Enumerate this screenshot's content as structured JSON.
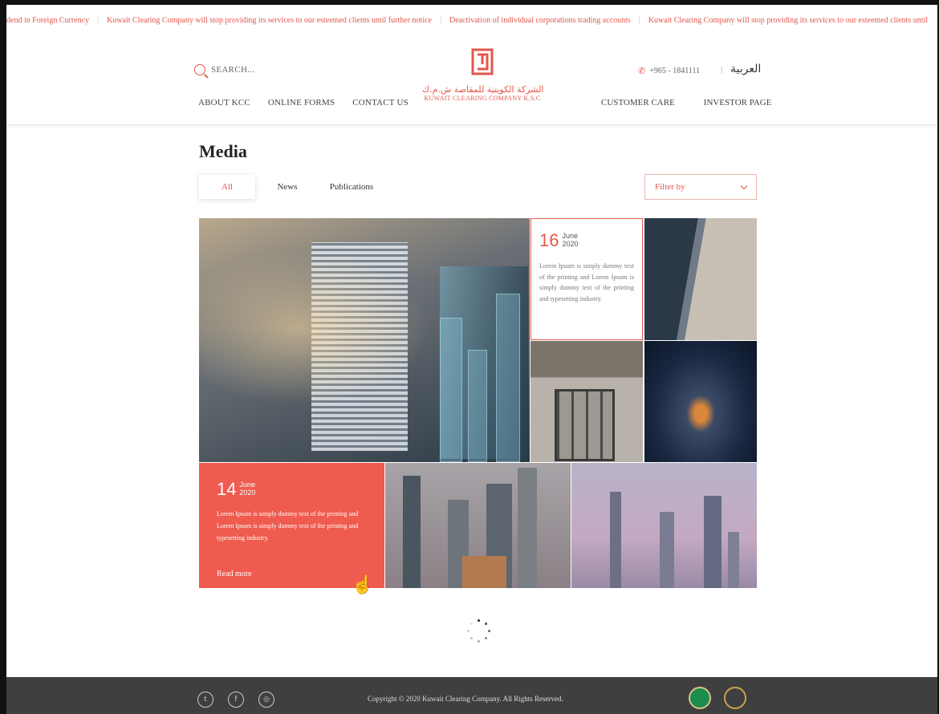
{
  "ticker": {
    "items": [
      "dend in Foreign Currency",
      "Kuwait Clearing Company will stop providing its services to our esteemed clients until further notice",
      "Deactivation of individual corporations trading accounts",
      "Kuwait Clearing Company will stop providing its services to our esteemed clients until"
    ],
    "separator": "|"
  },
  "header": {
    "search_label": "SEARCH...",
    "phone": "+965 - 1841111",
    "pipe": "|",
    "language": "العربية",
    "nav_left": [
      "ABOUT KCC",
      "ONLINE FORMS",
      "CONTACT US"
    ],
    "nav_right": [
      "CUSTOMER CARE",
      "INVESTOR PAGE"
    ],
    "logo_arabic": "الشركة الكويتية للمقاصة ش.م.ك",
    "logo_english": "KUWAIT CLEARING COMPANY K.S.C"
  },
  "page": {
    "title": "Media",
    "tabs": [
      "All",
      "News",
      "Publications"
    ],
    "active_tab": "All",
    "filter_placeholder": "Filter by"
  },
  "cards": [
    {
      "day": "16",
      "month": "June",
      "year": "2020",
      "text": "Lorem Ipsum is simply dummy text of the printing and Lorem Ipsum is simply dummy text of the printing and typesetting industry."
    },
    {
      "day": "14",
      "month": "June",
      "year": "2020",
      "text": "Lorem Ipsum is simply dummy text of the printing and Lorem Ipsum is simply dummy text of the printing and typesetting industry.",
      "link": "Read more"
    }
  ],
  "footer": {
    "copyright": "Copyright © 2020 Kuwait Clearing Company. All Rights Reserved.",
    "social_icons": [
      "twitter-icon",
      "facebook-icon",
      "instagram-icon"
    ]
  },
  "colors": {
    "accent": "#e2574c",
    "card_red": "#ef5b4e",
    "footer_bg": "#3f3f3f"
  }
}
